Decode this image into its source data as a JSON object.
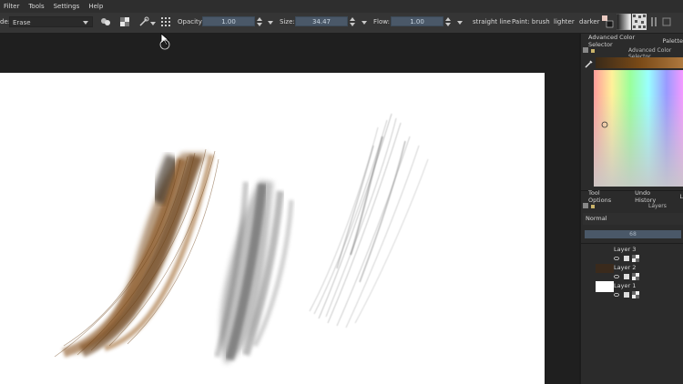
{
  "menu": [
    "Filter",
    "Tools",
    "Settings",
    "Help"
  ],
  "toolbar": {
    "blend_mode_prefix": "de:",
    "blend_mode": "Erase",
    "opacity_label": "Opacity:",
    "opacity_value": "1.00",
    "size_label": "Size:",
    "size_value": "34.47",
    "flow_label": "Flow:",
    "flow_value": "1.00",
    "straight_line": "straight line",
    "paint_brush": "Paint: brush",
    "lighter": "lighter",
    "darker": "darker"
  },
  "dock": {
    "color_tab": "Advanced Color Selector",
    "palette_tab": "Palette",
    "color_panel_title": "Advanced Color Selector",
    "tool_options_tab": "Tool Options",
    "undo_tab": "Undo History",
    "extra_tab": "L",
    "layers_title": "Layers",
    "blend_mode": "Normal",
    "opacity": "68",
    "layers": [
      {
        "name": "Layer 3"
      },
      {
        "name": "Layer 2"
      },
      {
        "name": "Layer 1"
      }
    ]
  },
  "colors": {
    "brown_stroke": "#7a4a17",
    "dark_stroke": "#4a4a4a",
    "light_stroke": "#9a9a9a",
    "selection_bar": "#4a5868"
  }
}
